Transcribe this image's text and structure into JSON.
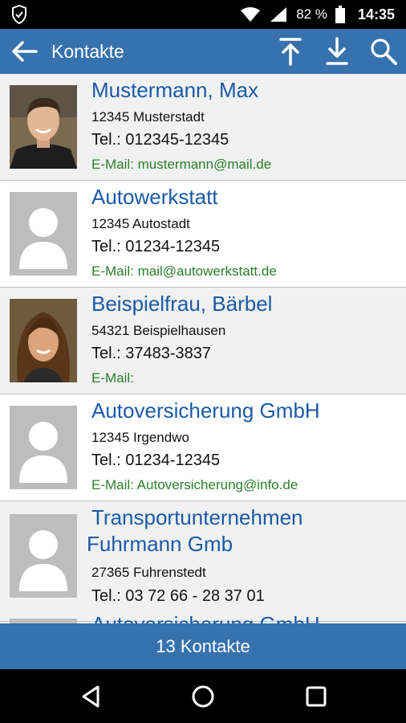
{
  "status": {
    "battery_percent": "82 %",
    "time": "14:35",
    "icons": [
      "shield-icon",
      "wifi-icon",
      "signal-icon",
      "battery-icon"
    ]
  },
  "appbar": {
    "title": "Kontakte",
    "icons": [
      "back-arrow-icon",
      "scroll-top-icon",
      "download-icon",
      "search-icon"
    ]
  },
  "contacts": [
    {
      "name": "Mustermann, Max",
      "city": "12345 Musterstadt",
      "tel": "Tel.: 012345-12345",
      "mail": "E-Mail: mustermann@mail.de",
      "photo": "male-photo"
    },
    {
      "name": "Autowerkstatt",
      "city": "12345 Autostadt",
      "tel": "Tel.: 01234-12345",
      "mail": "E-Mail: mail@autowerkstatt.de",
      "photo": "placeholder"
    },
    {
      "name": "Beispielfrau, Bärbel",
      "city": "54321 Beispielhausen",
      "tel": "Tel.: 37483-3837",
      "mail": "E-Mail:",
      "photo": "female-photo"
    },
    {
      "name": "Autoversicherung GmbH",
      "city": "12345 Irgendwo",
      "tel": "Tel.: 01234-12345",
      "mail": "E-Mail: Autoversicherung@info.de",
      "photo": "placeholder"
    },
    {
      "name_line1": "Transportunternehmen",
      "name_line2": "Fuhrmann Gmb",
      "city": "27365 Fuhrenstedt",
      "tel": "Tel.: 03 72 66 - 28 37 01",
      "photo": "placeholder"
    },
    {
      "name": "Autoversicherung GmbH",
      "photo": "placeholder"
    }
  ],
  "footer": {
    "count_label": "13 Kontakte"
  },
  "navbar": {
    "icons": [
      "back-triangle-icon",
      "home-circle-icon",
      "recents-square-icon"
    ]
  },
  "colors": {
    "primary": "#3672ae",
    "name_text": "#1a5aa7",
    "mail_text": "#2c7d2c"
  }
}
